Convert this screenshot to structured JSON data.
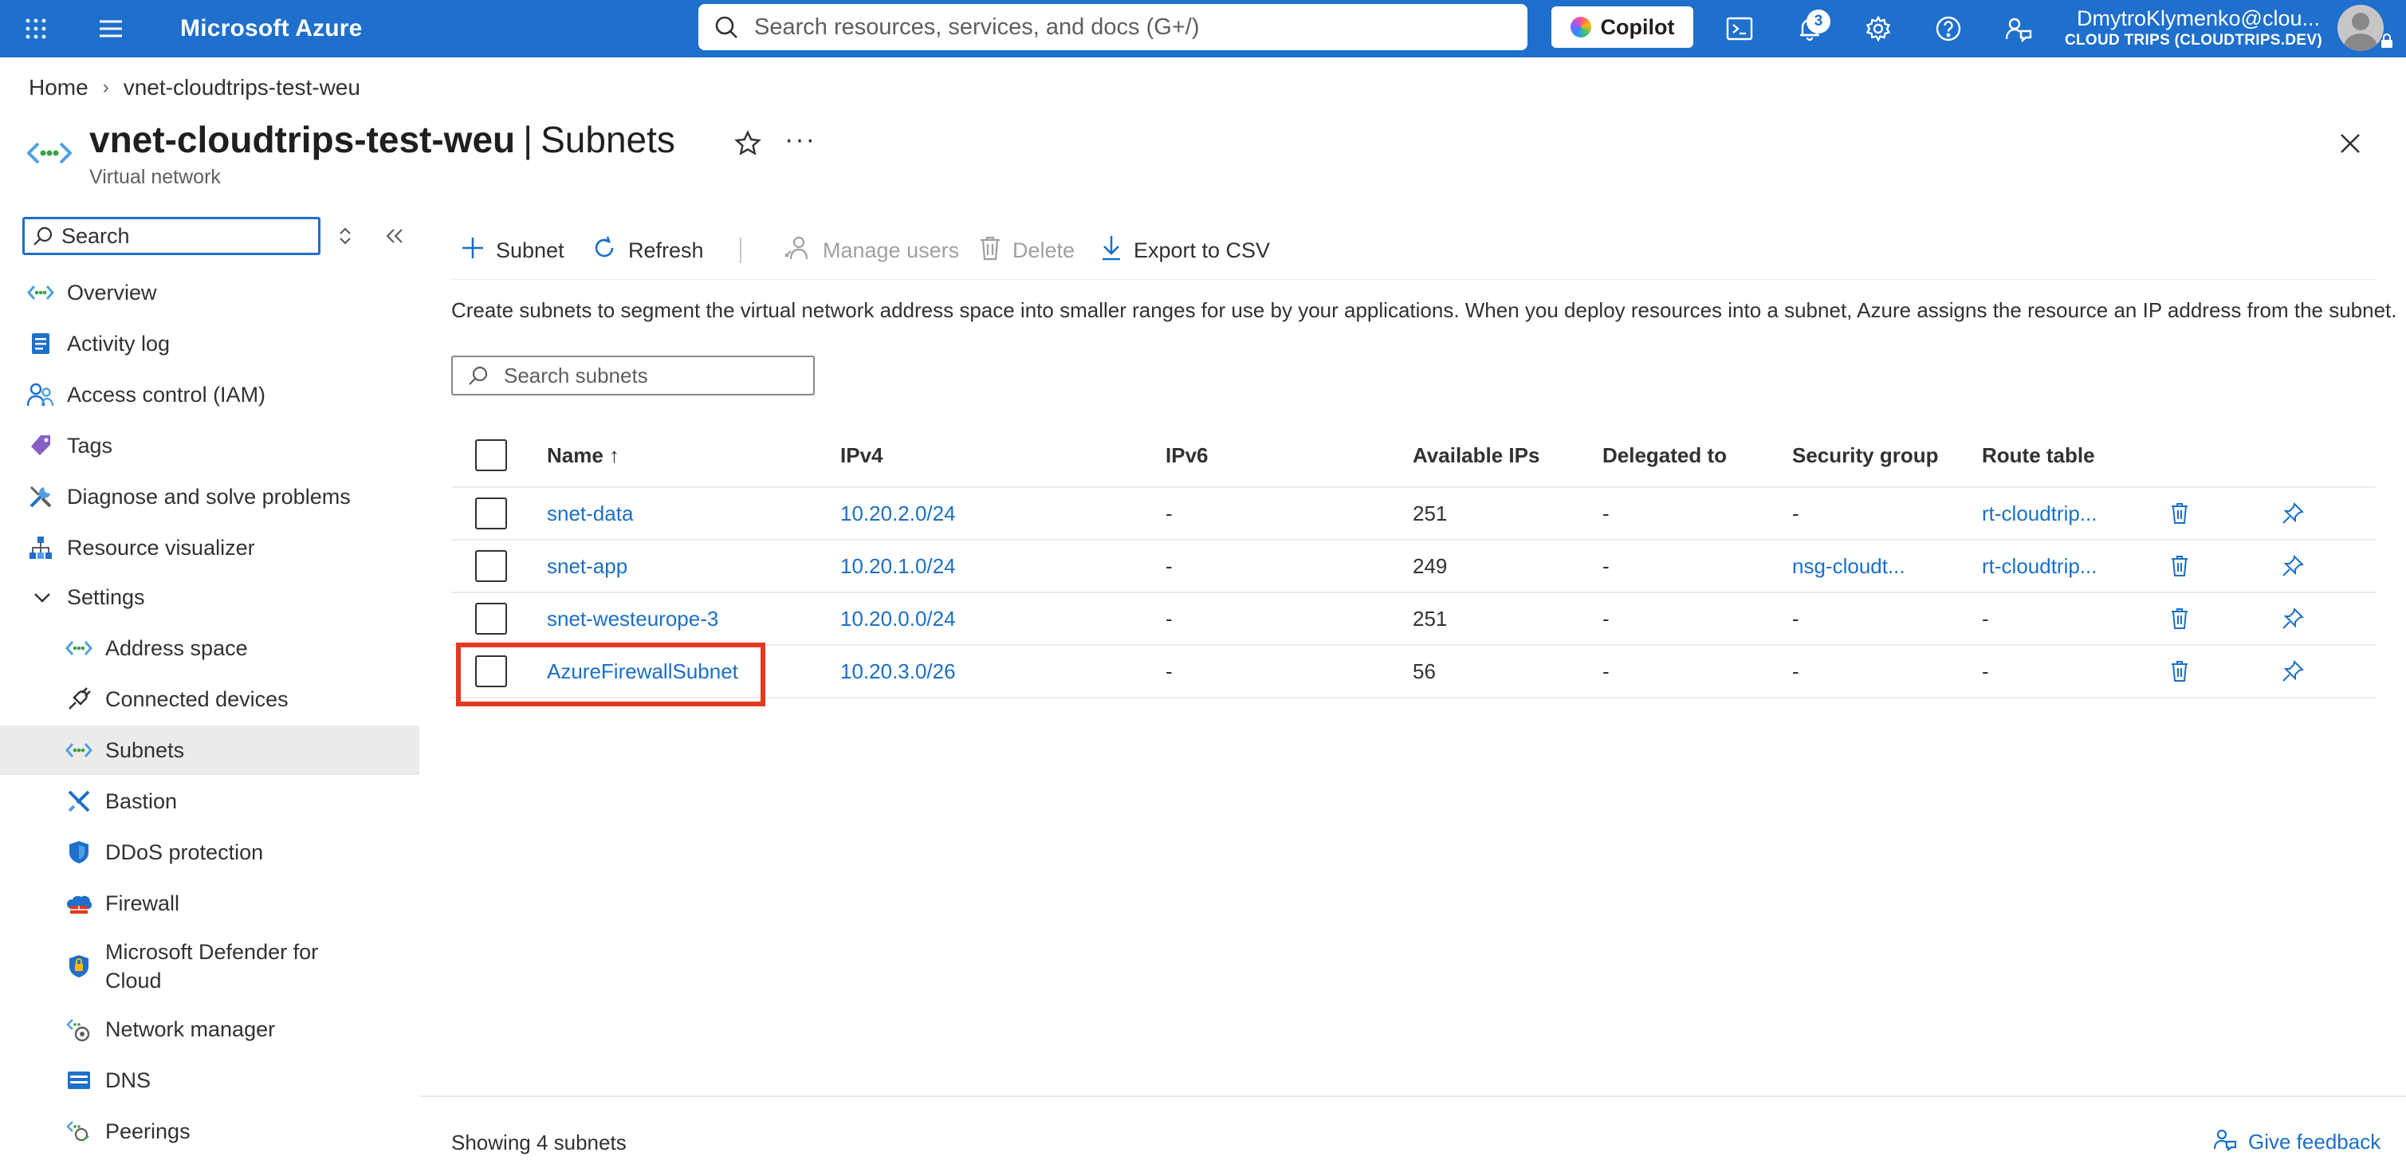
{
  "topbar": {
    "brand": "Microsoft Azure",
    "search_placeholder": "Search resources, services, and docs (G+/)",
    "copilot_label": "Copilot",
    "notification_count": "3",
    "account_name": "DmytroKlymenko@clou...",
    "account_tenant": "CLOUD TRIPS (CLOUDTRIPS.DEV)"
  },
  "breadcrumb": {
    "home": "Home",
    "resource": "vnet-cloudtrips-test-weu"
  },
  "header": {
    "resource_name": "vnet-cloudtrips-test-weu",
    "separator": "|",
    "blade": "Subnets",
    "subtitle": "Virtual network",
    "more": "···"
  },
  "nav": {
    "search_placeholder": "Search",
    "items": [
      {
        "label": "Overview",
        "icon": "vnet-icon"
      },
      {
        "label": "Activity log",
        "icon": "activity-log-icon"
      },
      {
        "label": "Access control (IAM)",
        "icon": "iam-icon"
      },
      {
        "label": "Tags",
        "icon": "tag-icon"
      },
      {
        "label": "Diagnose and solve problems",
        "icon": "wrench-icon"
      },
      {
        "label": "Resource visualizer",
        "icon": "visualizer-icon"
      },
      {
        "label": "Settings",
        "icon": "chevron-down-icon"
      },
      {
        "label": "Address space",
        "icon": "vnet-icon"
      },
      {
        "label": "Connected devices",
        "icon": "plug-icon"
      },
      {
        "label": "Subnets",
        "icon": "vnet-icon"
      },
      {
        "label": "Bastion",
        "icon": "bastion-icon"
      },
      {
        "label": "DDoS protection",
        "icon": "shield-icon"
      },
      {
        "label": "Firewall",
        "icon": "firewall-icon"
      },
      {
        "label": "Microsoft Defender for Cloud",
        "icon": "defender-icon"
      },
      {
        "label": "Network manager",
        "icon": "network-manager-icon"
      },
      {
        "label": "DNS",
        "icon": "dns-icon"
      },
      {
        "label": "Peerings",
        "icon": "peering-icon"
      }
    ],
    "selected": "Subnets"
  },
  "commands": {
    "add_subnet": "Subnet",
    "refresh": "Refresh",
    "manage_users": "Manage users",
    "delete": "Delete",
    "export": "Export to CSV"
  },
  "description": "Create subnets to segment the virtual network address space into smaller ranges for use by your applications. When you deploy resources into a subnet, Azure assigns the resource an IP address from the subnet.",
  "subnet_search_placeholder": "Search subnets",
  "table": {
    "columns": [
      "Name ↑",
      "IPv4",
      "IPv6",
      "Available IPs",
      "Delegated to",
      "Security group",
      "Route table"
    ],
    "rows": [
      {
        "name": "snet-data",
        "ipv4": "10.20.2.0/24",
        "ipv6": "-",
        "available": "251",
        "delegated": "-",
        "nsg": "-",
        "route": "rt-cloudtrip..."
      },
      {
        "name": "snet-app",
        "ipv4": "10.20.1.0/24",
        "ipv6": "-",
        "available": "249",
        "delegated": "-",
        "nsg": "nsg-cloudt...",
        "route": "rt-cloudtrip..."
      },
      {
        "name": "snet-westeurope-3",
        "ipv4": "10.20.0.0/24",
        "ipv6": "-",
        "available": "251",
        "delegated": "-",
        "nsg": "-",
        "route": "-"
      },
      {
        "name": "AzureFirewallSubnet",
        "ipv4": "10.20.3.0/26",
        "ipv6": "-",
        "available": "56",
        "delegated": "-",
        "nsg": "-",
        "route": "-"
      }
    ],
    "highlighted_row": "AzureFirewallSubnet"
  },
  "footer": {
    "count": "Showing 4 subnets",
    "feedback": "Give feedback"
  },
  "colors": {
    "topbar": "#1f6fcc",
    "link": "#1a6fc9",
    "highlight": "#e3391f",
    "selected_nav": "#edebe9"
  }
}
